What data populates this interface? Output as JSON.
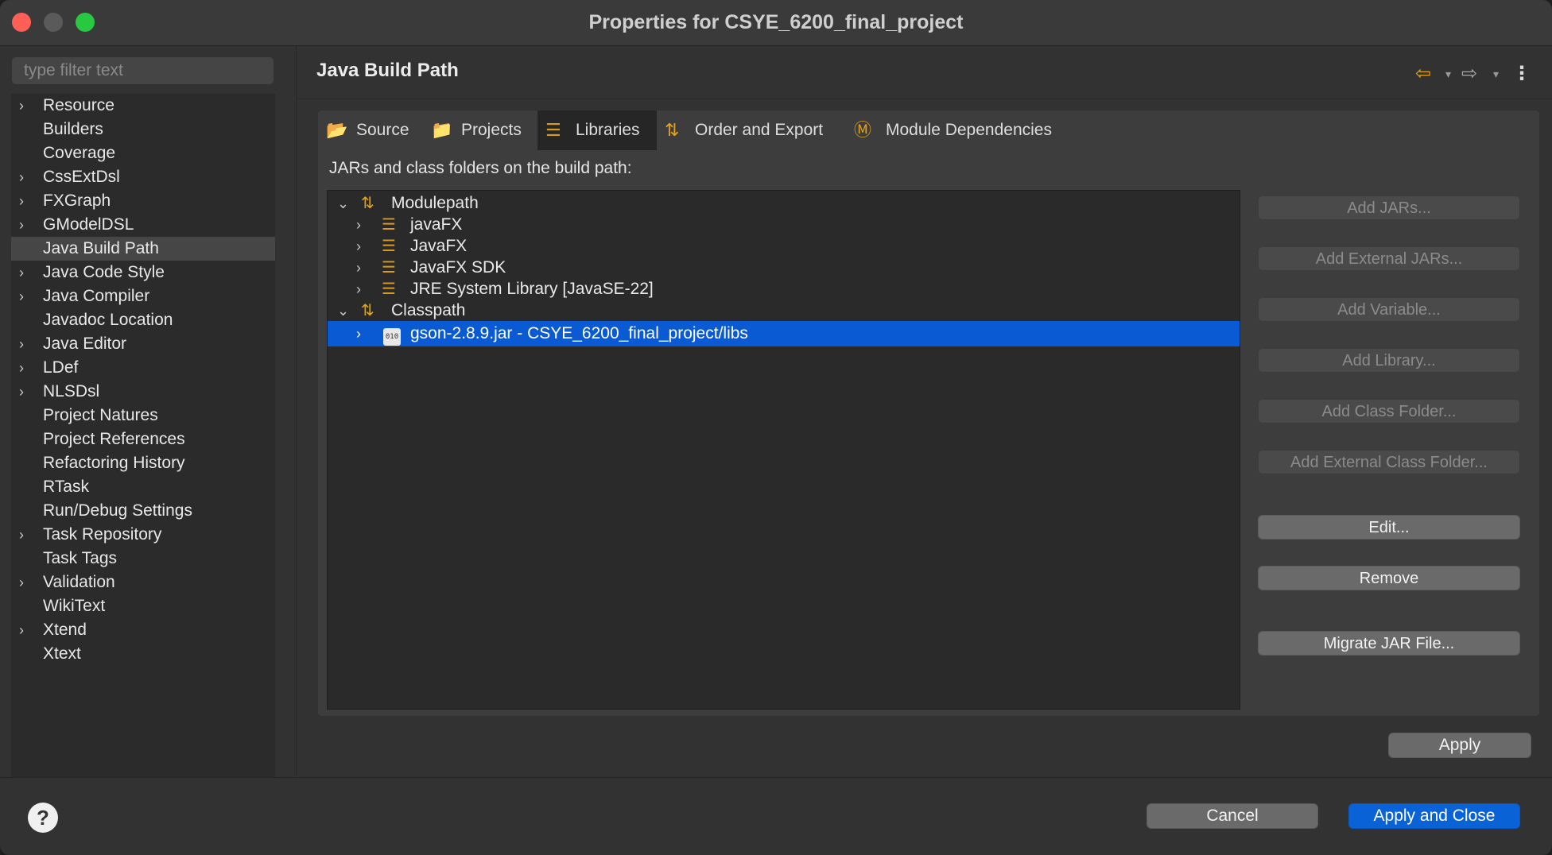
{
  "window": {
    "title": "Properties for CSYE_6200_final_project"
  },
  "sidebar": {
    "filter_placeholder": "type filter text",
    "items": [
      {
        "label": "Resource",
        "expandable": true
      },
      {
        "label": "Builders",
        "expandable": false
      },
      {
        "label": "Coverage",
        "expandable": false
      },
      {
        "label": "CssExtDsl",
        "expandable": true
      },
      {
        "label": "FXGraph",
        "expandable": true
      },
      {
        "label": "GModelDSL",
        "expandable": true
      },
      {
        "label": "Java Build Path",
        "expandable": false,
        "selected": true
      },
      {
        "label": "Java Code Style",
        "expandable": true
      },
      {
        "label": "Java Compiler",
        "expandable": true
      },
      {
        "label": "Javadoc Location",
        "expandable": false
      },
      {
        "label": "Java Editor",
        "expandable": true
      },
      {
        "label": "LDef",
        "expandable": true
      },
      {
        "label": "NLSDsl",
        "expandable": true
      },
      {
        "label": "Project Natures",
        "expandable": false
      },
      {
        "label": "Project References",
        "expandable": false
      },
      {
        "label": "Refactoring History",
        "expandable": false
      },
      {
        "label": "RTask",
        "expandable": false
      },
      {
        "label": "Run/Debug Settings",
        "expandable": false
      },
      {
        "label": "Task Repository",
        "expandable": true
      },
      {
        "label": "Task Tags",
        "expandable": false
      },
      {
        "label": "Validation",
        "expandable": true
      },
      {
        "label": "WikiText",
        "expandable": false
      },
      {
        "label": "Xtend",
        "expandable": true
      },
      {
        "label": "Xtext",
        "expandable": false
      }
    ]
  },
  "main": {
    "page_title": "Java Build Path",
    "tabs": [
      {
        "label": "Source",
        "icon": "source-folder-icon"
      },
      {
        "label": "Projects",
        "icon": "projects-icon"
      },
      {
        "label": "Libraries",
        "icon": "libraries-icon",
        "active": true
      },
      {
        "label": "Order and Export",
        "icon": "order-export-icon"
      },
      {
        "label": "Module Dependencies",
        "icon": "module-icon"
      }
    ],
    "caption": "JARs and class folders on the build path:",
    "tree": [
      {
        "label": "Modulepath",
        "level": 0,
        "expanded": true,
        "icon": "path-icon"
      },
      {
        "label": "javaFX",
        "level": 1,
        "icon": "library-icon"
      },
      {
        "label": "JavaFX",
        "level": 1,
        "icon": "library-icon"
      },
      {
        "label": "JavaFX SDK",
        "level": 1,
        "icon": "library-icon"
      },
      {
        "label": "JRE System Library [JavaSE-22]",
        "level": 1,
        "icon": "library-icon"
      },
      {
        "label": "Classpath",
        "level": 0,
        "expanded": true,
        "icon": "path-icon"
      },
      {
        "label": "gson-2.8.9.jar - CSYE_6200_final_project/libs",
        "level": 1,
        "icon": "jar-icon",
        "jar_glyph": "010",
        "selected": true
      }
    ],
    "buttons": [
      {
        "label": "Add JARs...",
        "enabled": false
      },
      {
        "label": "Add External JARs...",
        "enabled": false
      },
      {
        "label": "Add Variable...",
        "enabled": false
      },
      {
        "label": "Add Library...",
        "enabled": false
      },
      {
        "label": "Add Class Folder...",
        "enabled": false
      },
      {
        "label": "Add External Class Folder...",
        "enabled": false
      },
      {
        "label": "Edit...",
        "enabled": true
      },
      {
        "label": "Remove",
        "enabled": true
      },
      {
        "label": "Migrate JAR File...",
        "enabled": true
      }
    ],
    "apply_label": "Apply"
  },
  "footer": {
    "help_glyph": "?",
    "cancel_label": "Cancel",
    "apply_close_label": "Apply and Close"
  },
  "colors": {
    "selection": "#0a5bd3",
    "primary_button": "#0a63d6",
    "accent_icon": "#e3a21a"
  }
}
